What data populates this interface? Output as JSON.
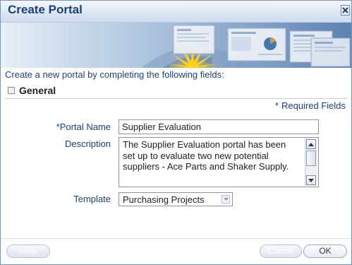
{
  "dialog": {
    "title": "Create Portal",
    "close_icon": "close-icon"
  },
  "form": {
    "instructions": "Create a new portal by completing the following fields:",
    "section_title": "General",
    "required_marker": "*",
    "required_note": "Required Fields",
    "portal_name": {
      "label": "Portal Name",
      "value": "Supplier Evaluation"
    },
    "description": {
      "label": "Description",
      "value": "The Supplier Evaluation portal has been set up to evaluate two new potential suppliers - Ace Parts and Shaker Supply."
    },
    "template": {
      "label": "Template",
      "selected": "Purchasing Projects"
    }
  },
  "footer": {
    "help_label": "Help",
    "cancel_label": "Cancel",
    "ok_label": "OK"
  },
  "colors": {
    "title": "#1e3f78",
    "label": "#1d3f80",
    "border": "#7a96bd"
  }
}
